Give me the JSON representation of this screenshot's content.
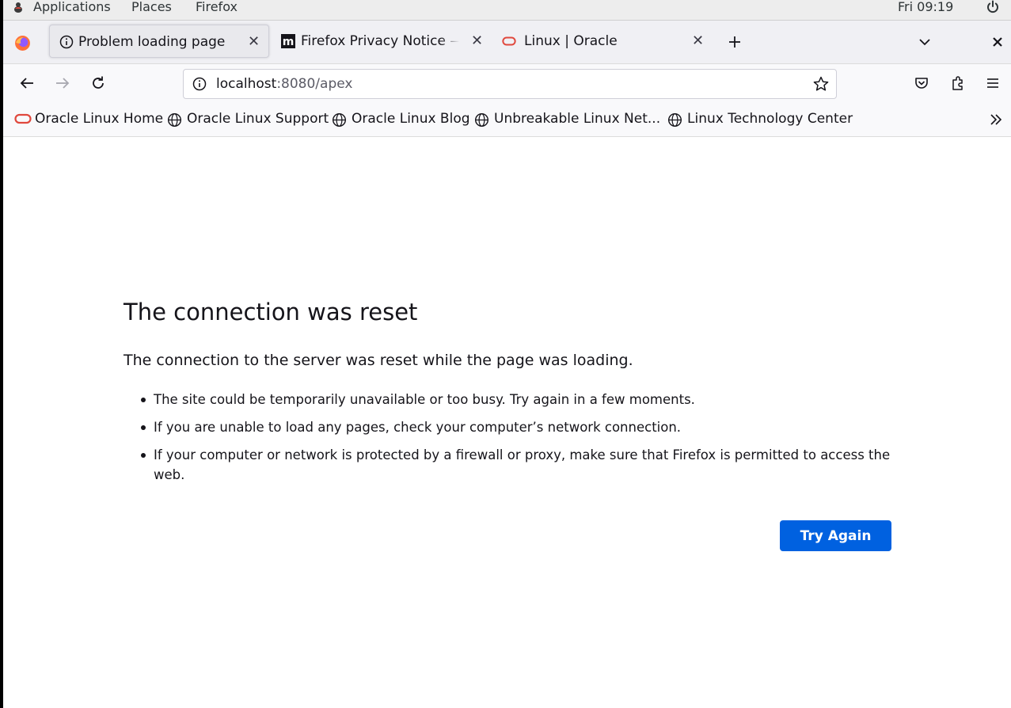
{
  "topbar": {
    "applications": "Applications",
    "places": "Places",
    "firefox": "Firefox",
    "clock": "Fri 09:19"
  },
  "tabs": [
    {
      "label": "Problem loading page",
      "icon": "info-icon",
      "active": true
    },
    {
      "label": "Firefox Privacy Notice — M",
      "icon": "mozilla-m-icon",
      "active": false
    },
    {
      "label": "Linux | Oracle",
      "icon": "oracle-icon",
      "active": false
    }
  ],
  "url": {
    "host": "localhost",
    "rest": ":8080/apex"
  },
  "bookmarks": [
    {
      "label": "Oracle Linux Home",
      "icon": "oracle-icon"
    },
    {
      "label": "Oracle Linux Support",
      "icon": "globe-icon"
    },
    {
      "label": "Oracle Linux Blog",
      "icon": "globe-icon"
    },
    {
      "label": "Unbreakable Linux Net...",
      "icon": "globe-icon"
    },
    {
      "label": "Linux Technology Center",
      "icon": "globe-icon"
    }
  ],
  "error": {
    "title": "The connection was reset",
    "description": "The connection to the server was reset while the page was loading.",
    "items": [
      "The site could be temporarily unavailable or too busy. Try again in a few moments.",
      "If you are unable to load any pages, check your computer’s network connection.",
      "If your computer or network is protected by a firewall or proxy, make sure that Firefox is permitted to access the web."
    ],
    "button": "Try Again"
  },
  "colors": {
    "accent": "#0061e0",
    "oracle_red": "#e0483d"
  }
}
